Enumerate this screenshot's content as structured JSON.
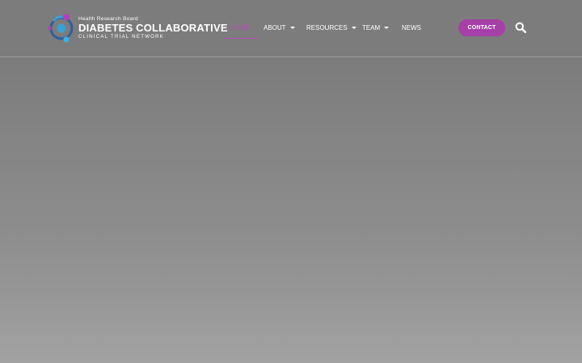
{
  "brand": {
    "top_line": "Health Research Board",
    "main_line": "DIABETES COLLABORATIVE",
    "sub_line": "CLINICAL TRIAL NETWORK"
  },
  "nav": {
    "items": [
      {
        "label": "HOME",
        "active": true,
        "dropdown": false
      },
      {
        "label": "ABOUT",
        "active": false,
        "dropdown": true
      },
      {
        "label": "RESOURCES",
        "active": false,
        "dropdown": true
      },
      {
        "label": "TEAM",
        "active": false,
        "dropdown": true
      },
      {
        "label": "NEWS",
        "active": false,
        "dropdown": false
      }
    ]
  },
  "header_actions": {
    "contact_label": "CONTACT",
    "search_icon": "search-icon"
  },
  "colors": {
    "accent": "#a640a8",
    "active_nav": "#b24fb6",
    "overlay": "#7c7c7c",
    "logo_blue": "#3aa0d8",
    "logo_dark_blue": "#2c5b97",
    "logo_magenta": "#b33fb7"
  }
}
